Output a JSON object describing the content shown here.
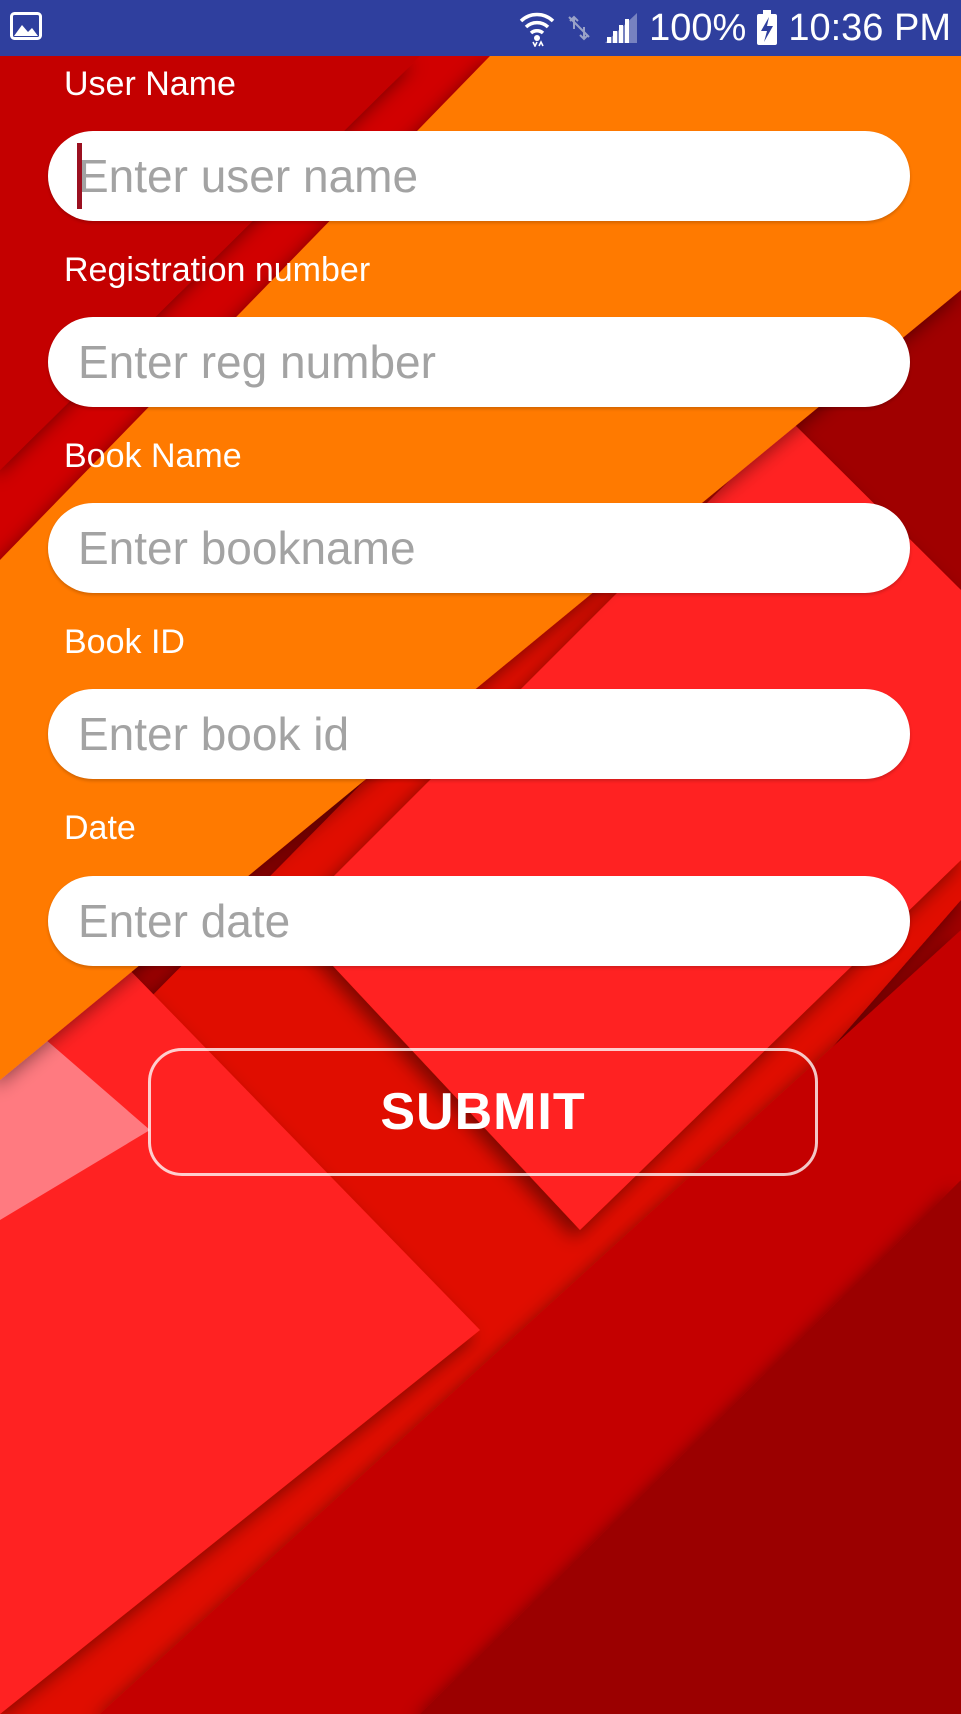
{
  "status_bar": {
    "battery_text": "100%",
    "time": "10:36 PM",
    "icons": [
      "gallery-icon",
      "wifi-icon",
      "data-off-icon",
      "signal-icon",
      "battery-charging-icon"
    ]
  },
  "form": {
    "fields": [
      {
        "label": "User Name",
        "placeholder": "Enter user name",
        "value": "",
        "focused": true
      },
      {
        "label": "Registration number",
        "placeholder": "Enter reg number",
        "value": ""
      },
      {
        "label": "Book Name",
        "placeholder": "Enter bookname",
        "value": ""
      },
      {
        "label": "Book ID",
        "placeholder": "Enter book id",
        "value": ""
      },
      {
        "label": "Date",
        "placeholder": "Enter date",
        "value": ""
      }
    ],
    "submit_label": "SUBMIT"
  },
  "colors": {
    "status_bar": "#2f3f9e",
    "orange_band": "#ff7a00",
    "red": "#ff2020",
    "dark_red": "#9b0000",
    "caret": "#9b1020",
    "placeholder": "#a3a3a3"
  }
}
